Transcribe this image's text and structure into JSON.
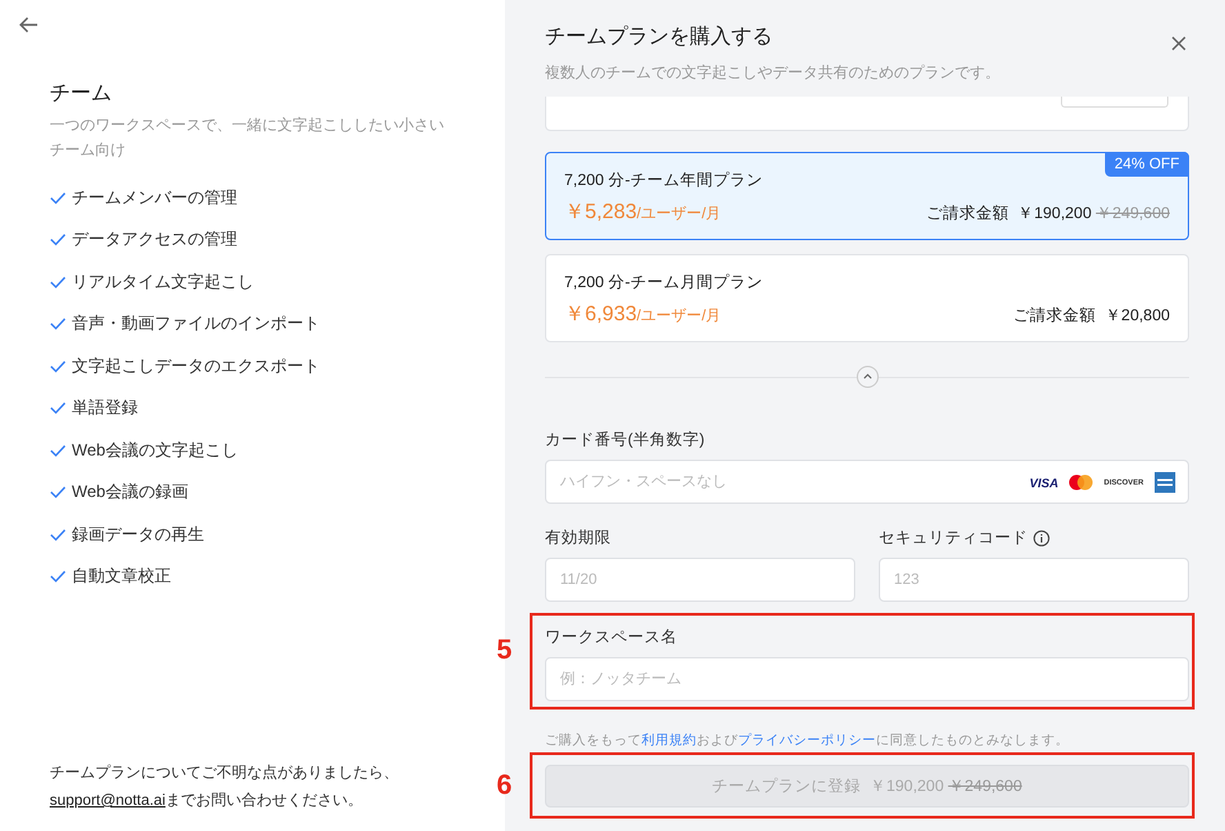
{
  "plan_info": {
    "title": "チーム",
    "description": "一つのワークスペースで、一緒に文字起こししたい小さいチーム向け",
    "features": [
      "チームメンバーの管理",
      "データアクセスの管理",
      "リアルタイム文字起こし",
      "音声・動画ファイルのインポート",
      "文字起こしデータのエクスポート",
      "単語登録",
      "Web会議の文字起こし",
      "Web会議の録画",
      "録画データの再生",
      "自動文章校正"
    ]
  },
  "support_note": {
    "before": "チームプランについてご不明な点がありましたら、",
    "email": "support@notta.ai",
    "after": "までお問い合わせください。"
  },
  "dialog": {
    "title": "チームプランを購入する",
    "subtitle": "複数人のチームでの文字起こしやデータ共有のためのプランです。",
    "plans": [
      {
        "name": "7,200 分-チーム年間プラン",
        "price": "￥5,283",
        "unit": "/ユーザー/月",
        "billing_label": "ご請求金額",
        "total": "￥190,200",
        "original_total": "￥249,600",
        "badge": "24% OFF",
        "selected": true
      },
      {
        "name": "7,200 分-チーム月間プラン",
        "price": "￥6,933",
        "unit": "/ユーザー/月",
        "billing_label": "ご請求金額",
        "total": "￥20,800",
        "selected": false
      }
    ],
    "card_number": {
      "label": "カード番号(半角数字)",
      "placeholder": "ハイフン・スペースなし",
      "brands": [
        "VISA",
        "DISCOVER"
      ]
    },
    "expiry": {
      "label": "有効期限",
      "placeholder": "11/20"
    },
    "security_code": {
      "label": "セキュリティコード",
      "placeholder": "123"
    },
    "workspace_name": {
      "label": "ワークスペース名",
      "placeholder": "例：ノッタチーム"
    },
    "terms": {
      "before": "ご購入をもって",
      "link_terms": "利用規約",
      "middle": "および",
      "link_privacy": "プライバシーポリシー",
      "after": "に同意したものとみなします。"
    },
    "submit": {
      "label": "チームプランに登録",
      "total": "￥190,200",
      "original_total": "￥249,600",
      "disabled": true
    }
  },
  "annotations": [
    {
      "label": "5"
    },
    {
      "label": "6"
    }
  ]
}
